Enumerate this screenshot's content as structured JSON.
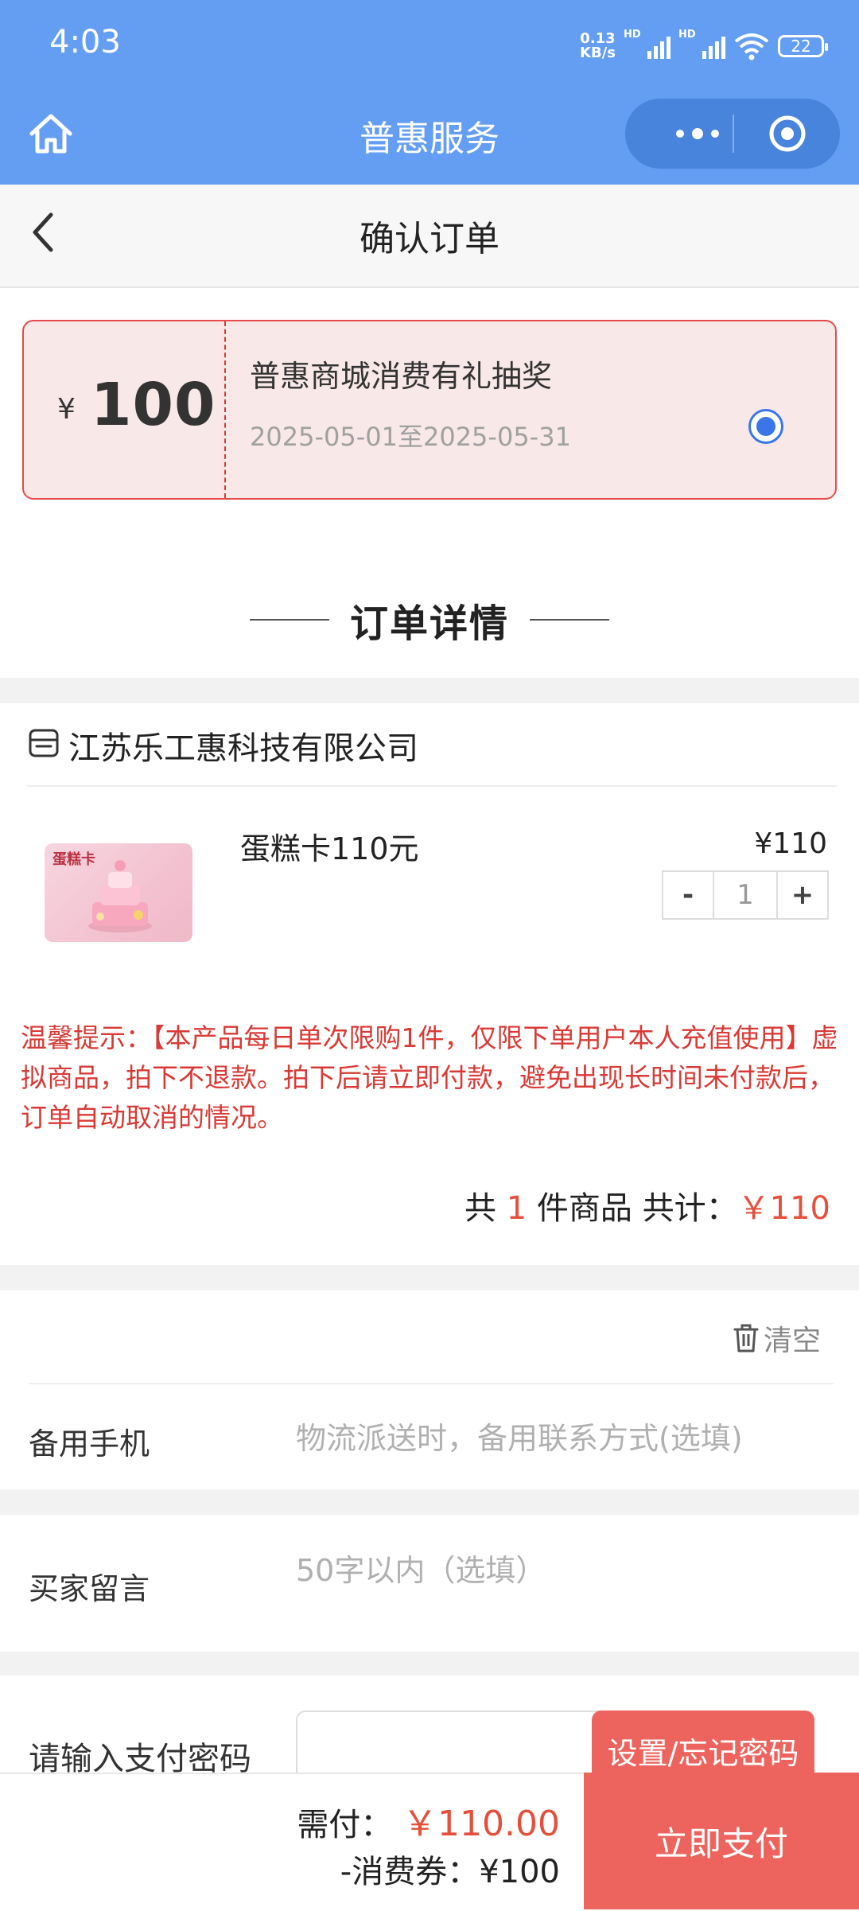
{
  "status_bar": {
    "time": "4:03",
    "net_speed_value": "0.13",
    "net_speed_unit": "KB/s",
    "hd_label": "HD",
    "battery": "22"
  },
  "nav": {
    "title": "普惠服务",
    "home_icon": "home-icon",
    "more_icon": "more-dots-icon",
    "close_icon": "target-icon"
  },
  "page": {
    "title": "确认订单",
    "back_icon": "chevron-left-icon"
  },
  "coupon": {
    "currency": "¥",
    "amount": "100",
    "name": "普惠商城消费有礼抽奖",
    "valid_period": "2025-05-01至2025-05-31",
    "selected": true
  },
  "order_detail": {
    "section_title": "订单详情",
    "shop_name": "江苏乐工惠科技有限公司",
    "product": {
      "image_label": "蛋糕卡",
      "name": "蛋糕卡110元",
      "price": "¥110",
      "quantity": "1",
      "minus_label": "-",
      "plus_label": "+"
    },
    "tip": "温馨提示：【本产品每日单次限购1件，仅限下单用户本人充值使用】虚拟商品，拍下不退款。拍下后请立即付款，避免出现长时间未付款后，订单自动取消的情况。",
    "total": {
      "prefix": "共 ",
      "count": "1",
      "middle": " 件商品 共计：",
      "amount": "￥110"
    }
  },
  "contact": {
    "clear_label": "清空",
    "phone_label": "备用手机",
    "phone_placeholder": "物流派送时，备用联系方式(选填)",
    "remark_label": "买家留言",
    "remark_placeholder": "50字以内（选填）"
  },
  "payment": {
    "password_label": "请输入支付密码",
    "set_password_label": "设置/忘记密码"
  },
  "bottom_bar": {
    "need_pay_label": "需付：",
    "need_pay_amount": "￥110.00",
    "coupon_deduct": "-消费券：¥100",
    "pay_button": "立即支付"
  },
  "colors": {
    "header_blue": "#649ef3",
    "accent_red": "#ec645d",
    "price_red": "#e5503c",
    "radio_blue": "#3b76e8"
  }
}
